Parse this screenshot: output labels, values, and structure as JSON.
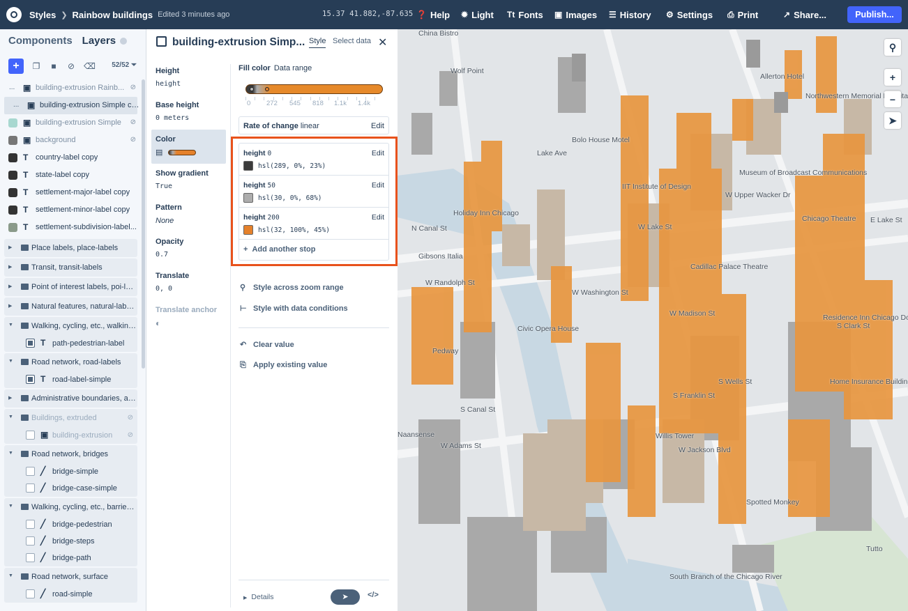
{
  "topbar": {
    "crumb_root": "Styles",
    "crumb_style": "Rainbow buildings",
    "edited": "Edited 3 minutes ago",
    "coords": "15.37 41.882,-87.635",
    "menu": [
      "Help",
      "Light",
      "Fonts",
      "Images",
      "History",
      "Settings",
      "Print",
      "Share..."
    ],
    "publish": "Publish..."
  },
  "left": {
    "tab_components": "Components",
    "tab_layers": "Layers",
    "layer_count": "52/52",
    "rows": [
      {
        "label": "building-extrusion Rainb...",
        "swatch": "#c9d0d6",
        "dim": true
      },
      {
        "label": "building-extrusion Simple co...",
        "swatch": "#dde4ec",
        "dim": false
      },
      {
        "label": "building-extrusion Simple",
        "swatch": "#a8d8d0",
        "dim": true
      },
      {
        "label": "background",
        "swatch": "#777777",
        "dim": true
      },
      {
        "label": "country-label copy",
        "swatch": "#333333",
        "dim": false
      },
      {
        "label": "state-label copy",
        "swatch": "#333333",
        "dim": false
      },
      {
        "label": "settlement-major-label copy",
        "swatch": "#333333",
        "dim": false
      },
      {
        "label": "settlement-minor-label copy",
        "swatch": "#333333",
        "dim": false
      },
      {
        "label": "settlement-subdivision-label...",
        "swatch": "#8a9a8a",
        "dim": false
      }
    ],
    "groups": [
      {
        "label": "Place labels, place-labels",
        "children": []
      },
      {
        "label": "Transit, transit-labels",
        "children": []
      },
      {
        "label": "Point of interest labels, poi-lab...",
        "children": []
      },
      {
        "label": "Natural features, natural-labels",
        "children": []
      },
      {
        "label": "Walking, cycling, etc., walking-...",
        "children": [
          {
            "label": "path-pedestrian-label",
            "on": true,
            "icon": "T"
          }
        ]
      },
      {
        "label": "Road network, road-labels",
        "children": [
          {
            "label": "road-label-simple",
            "on": true,
            "icon": "T"
          }
        ]
      },
      {
        "label": "Administrative boundaries, ad...",
        "children": []
      },
      {
        "label": "Buildings, extruded",
        "dim": true,
        "children": [
          {
            "label": "building-extrusion",
            "on": false,
            "icon": "cube"
          }
        ]
      },
      {
        "label": "Road network, bridges",
        "children": [
          {
            "label": "bridge-simple",
            "on": false,
            "icon": "/"
          },
          {
            "label": "bridge-case-simple",
            "on": false,
            "icon": "/"
          }
        ]
      },
      {
        "label": "Walking, cycling, etc., barriers-...",
        "children": [
          {
            "label": "bridge-pedestrian",
            "on": false,
            "icon": "/"
          },
          {
            "label": "bridge-steps",
            "on": false,
            "icon": "/"
          },
          {
            "label": "bridge-path",
            "on": false,
            "icon": "/"
          }
        ]
      },
      {
        "label": "Road network, surface",
        "children": [
          {
            "label": "road-simple",
            "on": false,
            "icon": "/"
          }
        ]
      }
    ]
  },
  "mid": {
    "title": "building-extrusion Simp...",
    "tab_style": "Style",
    "tab_data": "Select data",
    "props": [
      {
        "label": "Height",
        "value": "height"
      },
      {
        "label": "Base height",
        "value": "0 meters"
      },
      {
        "label": "Color",
        "value": ""
      },
      {
        "label": "Show gradient",
        "value": "True"
      },
      {
        "label": "Pattern",
        "value": "None"
      },
      {
        "label": "Opacity",
        "value": "0.7"
      },
      {
        "label": "Translate",
        "value": "0, 0"
      },
      {
        "label": "Translate anchor",
        "value": ""
      }
    ],
    "fill_label": "Fill color",
    "fill_mode": "Data range",
    "ticks": [
      "0",
      "272",
      "545",
      "818",
      "1.1k",
      "1.4k"
    ],
    "rate_label": "Rate of change",
    "rate_value": "linear",
    "edit": "Edit",
    "stops": [
      {
        "prop": "height",
        "value": "0",
        "color": "#3b3b3b",
        "hsl": "hsl(289, 0%, 23%)"
      },
      {
        "prop": "height",
        "value": "50",
        "color": "#adadad",
        "hsl": "hsl(30, 0%, 68%)"
      },
      {
        "prop": "height",
        "value": "200",
        "color": "#e5812b",
        "hsl": "hsl(32, 100%, 45%)"
      }
    ],
    "add_stop": "Add another stop",
    "zoom_range": "Style across zoom range",
    "data_cond": "Style with data conditions",
    "clear": "Clear value",
    "apply": "Apply existing value",
    "details": "Details"
  },
  "map": {
    "labels": [
      "China Bistro",
      "Wolf Point",
      "W Lake St",
      "W Randolph St",
      "W Washington St",
      "W Madison St",
      "W Adams St",
      "W Jackson Blvd",
      "S Wells St",
      "S Franklin St",
      "S Canal St",
      "N Canal St",
      "Civic Opera House",
      "Willis Tower",
      "Cadillac Palace Theatre",
      "Chicago Theatre",
      "Home Insurance Building",
      "Spotted Monkey",
      "Residence Inn Chicago Downtown/Loop",
      "Holiday Inn Chicago",
      "IIT Institute of Design",
      "Museum of Broadcast Communications",
      "W Upper Wacker Dr",
      "S Clark St",
      "E Lake St",
      "Tutto",
      "Naansense",
      "South Branch of the Chicago River",
      "Gibsons Italia",
      "Pedway",
      "Lake Ave",
      "Bolo House Motel",
      "Northwestern Memorial Hospital",
      "Allerton Hotel"
    ]
  }
}
